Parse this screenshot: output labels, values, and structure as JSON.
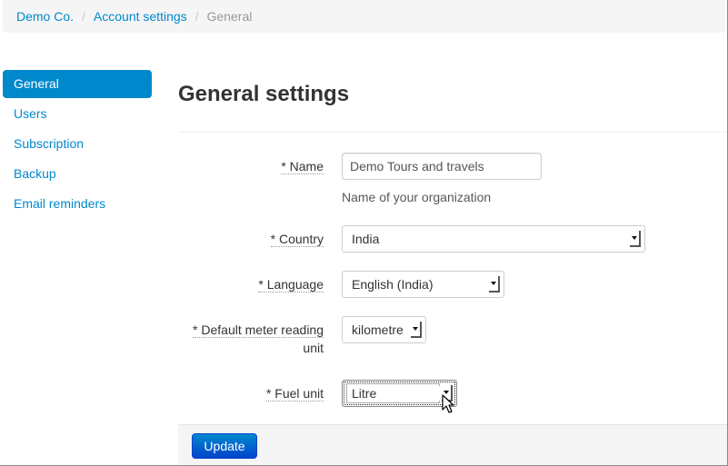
{
  "breadcrumb": {
    "items": [
      {
        "label": "Demo Co."
      },
      {
        "label": "Account settings"
      }
    ],
    "active": "General",
    "separator": "/"
  },
  "sidebar": {
    "items": [
      {
        "label": "General",
        "active": true
      },
      {
        "label": "Users"
      },
      {
        "label": "Subscription"
      },
      {
        "label": "Backup"
      },
      {
        "label": "Email reminders"
      }
    ]
  },
  "page": {
    "title": "General settings"
  },
  "form": {
    "name": {
      "label": "* Name",
      "value": "Demo Tours and travels",
      "help": "Name of your organization"
    },
    "country": {
      "label": "* Country",
      "value": "India"
    },
    "language": {
      "label": "* Language",
      "value": "English (India)"
    },
    "meter_unit": {
      "label_line1": "* Default meter reading",
      "label_line2": "unit",
      "value": "kilometre"
    },
    "fuel_unit": {
      "label": "* Fuel unit",
      "value": "Litre"
    }
  },
  "actions": {
    "update_label": "Update"
  },
  "colors": {
    "accent": "#0088cc",
    "breadcrumb_bg": "#f5f5f5"
  }
}
